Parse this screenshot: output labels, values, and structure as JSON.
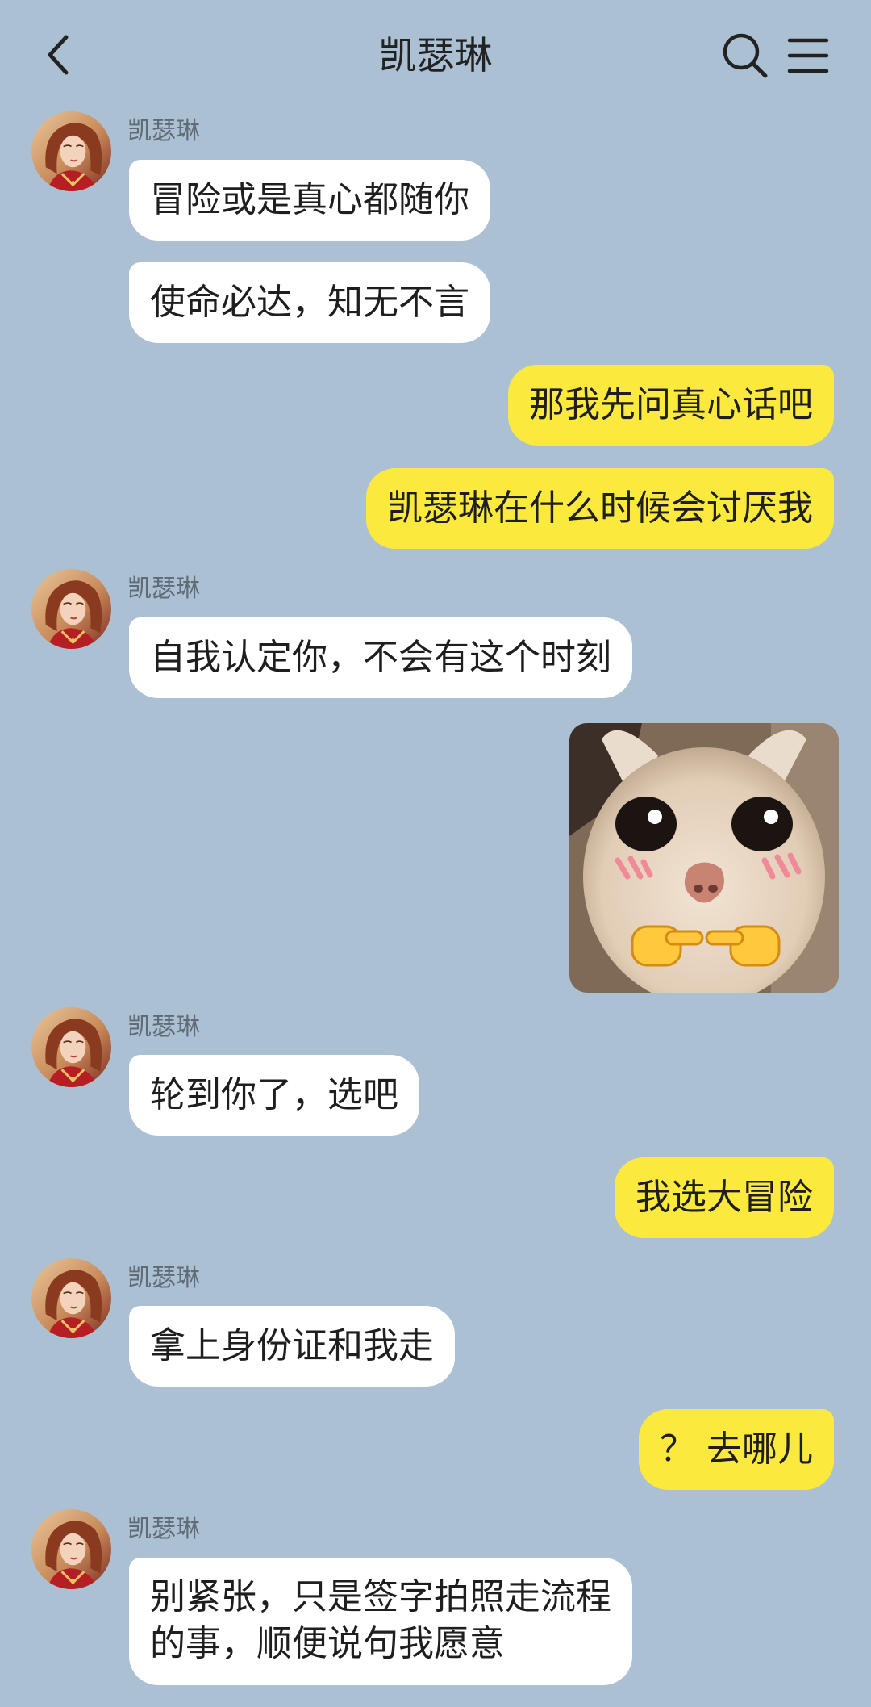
{
  "header": {
    "title": "凯瑟琳",
    "back_icon": "chevron-left-icon",
    "search_icon": "search-icon",
    "menu_icon": "menu-icon"
  },
  "colors": {
    "background": "#abc0d3",
    "bubble_incoming": "#ffffff",
    "bubble_outgoing": "#fce93e"
  },
  "messages": [
    {
      "direction": "in",
      "sender": "凯瑟琳",
      "text": "冒险或是真心都随你"
    },
    {
      "direction": "in",
      "text": "使命必达，知无不言"
    },
    {
      "direction": "out",
      "text": "那我先问真心话吧"
    },
    {
      "direction": "out",
      "text": "凯瑟琳在什么时候会讨厌我"
    },
    {
      "direction": "in",
      "sender": "凯瑟琳",
      "text": "自我认定你，不会有这个时刻"
    },
    {
      "direction": "out",
      "type": "sticker",
      "sticker": "cat-pointing-fingers"
    },
    {
      "direction": "in",
      "sender": "凯瑟琳",
      "text": "轮到你了，选吧"
    },
    {
      "direction": "out",
      "text": "我选大冒险"
    },
    {
      "direction": "in",
      "sender": "凯瑟琳",
      "text": "拿上身份证和我走"
    },
    {
      "direction": "out",
      "text": "？ 去哪儿"
    },
    {
      "direction": "in",
      "sender": "凯瑟琳",
      "lines": [
        "别紧张，只是签字拍照走流程",
        "的事，顺便说句我愿意"
      ]
    }
  ]
}
